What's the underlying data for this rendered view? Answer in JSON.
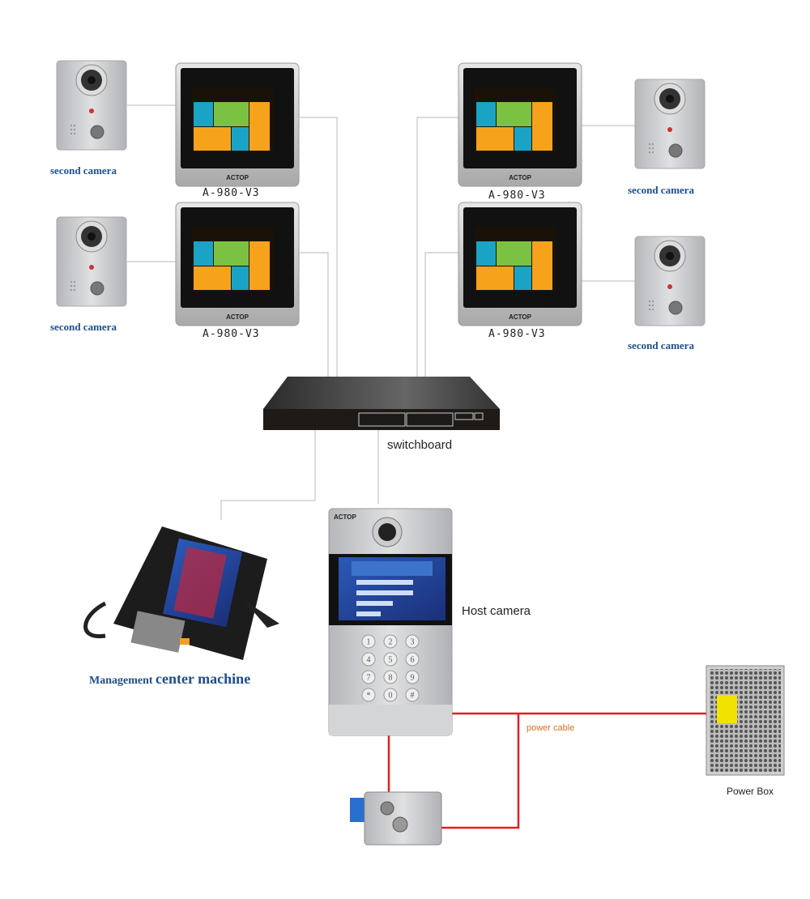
{
  "labels": {
    "second_camera": "second camera",
    "monitor_model": "A-980-V3",
    "monitor_brand": "ACTOP",
    "switch": "switchboard",
    "host_camera": "Host camera",
    "management_prefix": "Management",
    "management_suffix": "center machine",
    "power_cable": "power cable",
    "power_box": "Power Box"
  },
  "keypad": [
    "1",
    "2",
    "3",
    "4",
    "5",
    "6",
    "7",
    "8",
    "9",
    "*",
    "0",
    "#"
  ],
  "colors": {
    "network_line": "#b8b8b8",
    "power_line": "#e02020",
    "label_blue": "#1d4f8c",
    "power_text": "#e07020"
  }
}
